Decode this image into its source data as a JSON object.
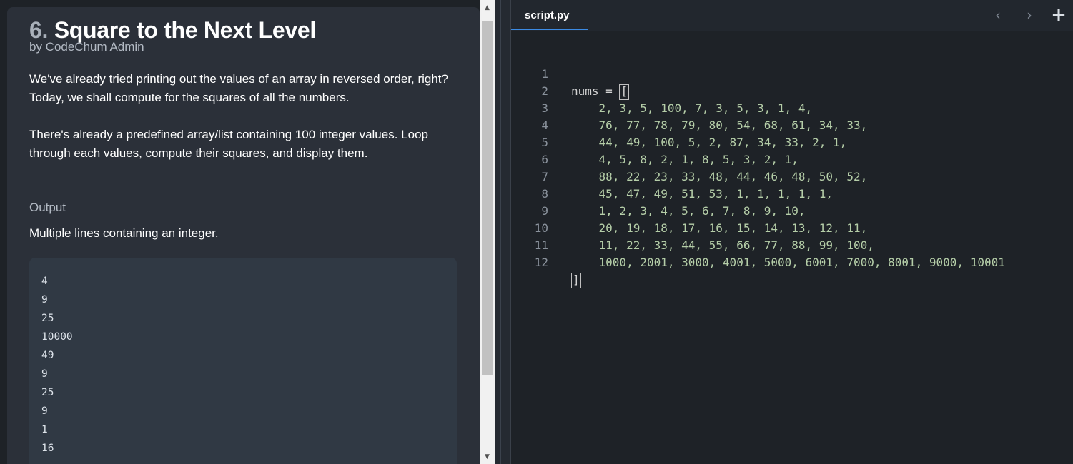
{
  "problem": {
    "number": "6.",
    "title": "Square to the Next Level",
    "author": "by CodeChum Admin",
    "description_1": "We've already tried printing out the values of an array in reversed order, right? Today, we shall compute for the squares of all the numbers.",
    "description_2": "There's already a predefined array/list containing 100 integer values. Loop through each values, compute their squares, and display them.",
    "output_heading": "Output",
    "output_description": "Multiple lines containing an integer.",
    "sample_output": [
      "4",
      "9",
      "25",
      "10000",
      "49",
      "9",
      "25",
      "9",
      "1",
      "16"
    ]
  },
  "scrollbar": {
    "up_icon": "▲",
    "down_icon": "▼"
  },
  "editor": {
    "tab_label": "script.py",
    "prev_icon": "‹",
    "next_icon": "›",
    "add_icon": "+",
    "first_line_prefix": "nums = ",
    "open_bracket": "[",
    "close_bracket": "]",
    "line_numbers": [
      "1",
      "2",
      "3",
      "4",
      "5",
      "6",
      "7",
      "8",
      "9",
      "10",
      "11",
      "12"
    ],
    "code_lines": [
      "    2, 3, 5, 100, 7, 3, 5, 3, 1, 4,",
      "    76, 77, 78, 79, 80, 54, 68, 61, 34, 33,",
      "    44, 49, 100, 5, 2, 87, 34, 33, 2, 1,",
      "    4, 5, 8, 2, 1, 8, 5, 3, 2, 1,",
      "    88, 22, 23, 33, 48, 44, 46, 48, 50, 52,",
      "    45, 47, 49, 51, 53, 1, 1, 1, 1, 1,",
      "    1, 2, 3, 4, 5, 6, 7, 8, 9, 10,",
      "    20, 19, 18, 17, 16, 15, 14, 13, 12, 11,",
      "    11, 22, 33, 44, 55, 66, 77, 88, 99, 100,",
      "    1000, 2001, 3000, 4001, 5000, 6001, 7000, 8001, 9000, 10001"
    ]
  },
  "colors": {
    "panel_bg": "#2b3039",
    "editor_bg": "#1e2227",
    "number_color": "#b5cea8",
    "accent": "#3c8be4"
  }
}
